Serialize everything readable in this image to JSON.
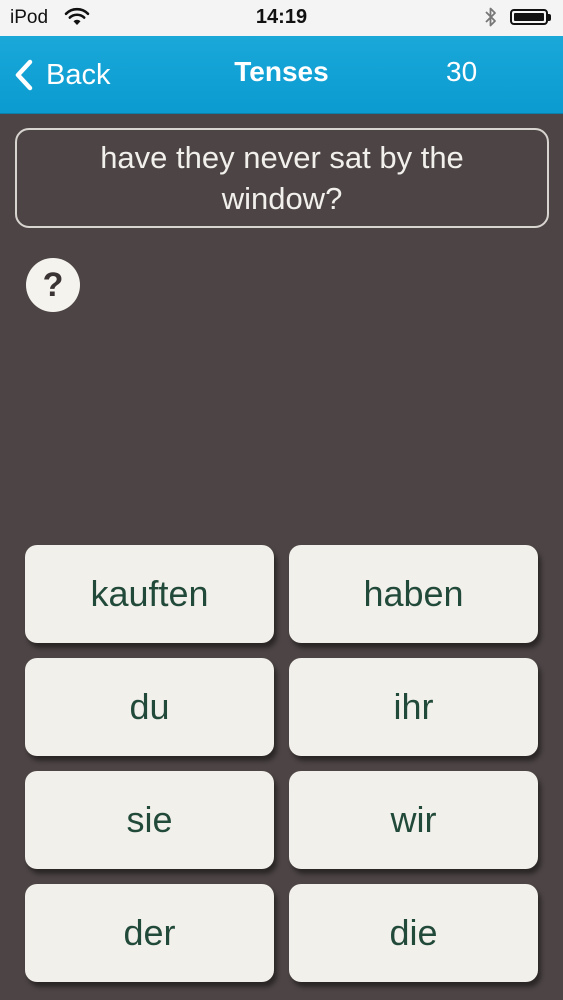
{
  "status_bar": {
    "carrier": "iPod",
    "time": "14:19"
  },
  "nav": {
    "back_label": "Back",
    "title": "Tenses",
    "counter": "30"
  },
  "question": {
    "text": "have they never sat by the window?"
  },
  "help": {
    "symbol": "?"
  },
  "answers": [
    "kauften",
    "haben",
    "du",
    "ihr",
    "sie",
    "wir",
    "der",
    "die"
  ],
  "colors": {
    "nav_bar": "#1aa8d9",
    "background": "#4d4545",
    "answer_button": "#f2f0eb",
    "answer_text": "#224a3a"
  }
}
